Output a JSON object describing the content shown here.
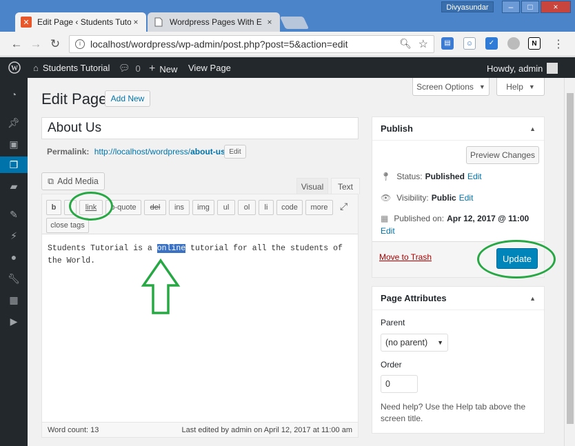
{
  "browser": {
    "tabs": [
      {
        "title": "Edit Page ‹ Students Tutor",
        "close": "×"
      },
      {
        "title": "Wordpress Pages With E",
        "close": "×"
      }
    ],
    "user": "Divyasundar",
    "window_controls": [
      "–",
      "□",
      "×"
    ],
    "url": "localhost/wordpress/wp-admin/post.php?post=5&action=edit",
    "ext_n": "N"
  },
  "admin_bar": {
    "site_name": "Students Tutorial",
    "comments_count": "0",
    "new_label": "New",
    "view_page": "View Page",
    "howdy": "Howdy, admin"
  },
  "page": {
    "heading": "Edit Page",
    "add_new": "Add New",
    "screen_options": "Screen Options",
    "help": "Help",
    "post_title": "About Us",
    "permalink_label": "Permalink:",
    "permalink_base": "http://localhost/wordpress/",
    "permalink_slug": "about-us/",
    "permalink_edit": "Edit",
    "add_media": "Add Media",
    "tab_visual": "Visual",
    "tab_text": "Text"
  },
  "toolbar": {
    "buttons": [
      "b",
      "i",
      "link",
      "b-quote",
      "del",
      "ins",
      "img",
      "ul",
      "ol",
      "li",
      "code",
      "more"
    ],
    "close_tags": "close tags"
  },
  "editor": {
    "text_before": "Students Tutorial is a ",
    "text_selected": "online",
    "text_after": " tutorial for all the students of the World.",
    "word_count": "Word count: 13",
    "last_edited": "Last edited by admin on April 12, 2017 at 11:00 am"
  },
  "publish": {
    "title": "Publish",
    "preview": "Preview Changes",
    "status_label": "Status:",
    "status_value": "Published",
    "visibility_label": "Visibility:",
    "visibility_value": "Public",
    "published_label": "Published on:",
    "published_value": "Apr 12, 2017 @ 11:00",
    "edit": "Edit",
    "trash": "Move to Trash",
    "update": "Update"
  },
  "attributes": {
    "title": "Page Attributes",
    "parent_label": "Parent",
    "parent_value": "(no parent)",
    "order_label": "Order",
    "order_value": "0",
    "help_text": "Need help? Use the Help tab above the screen title."
  },
  "colors": {
    "accent": "#0073aa",
    "update_button": "#0085ba",
    "annotation": "#28a745",
    "admin_bar": "#23282d",
    "selection": "#3b72c4"
  }
}
